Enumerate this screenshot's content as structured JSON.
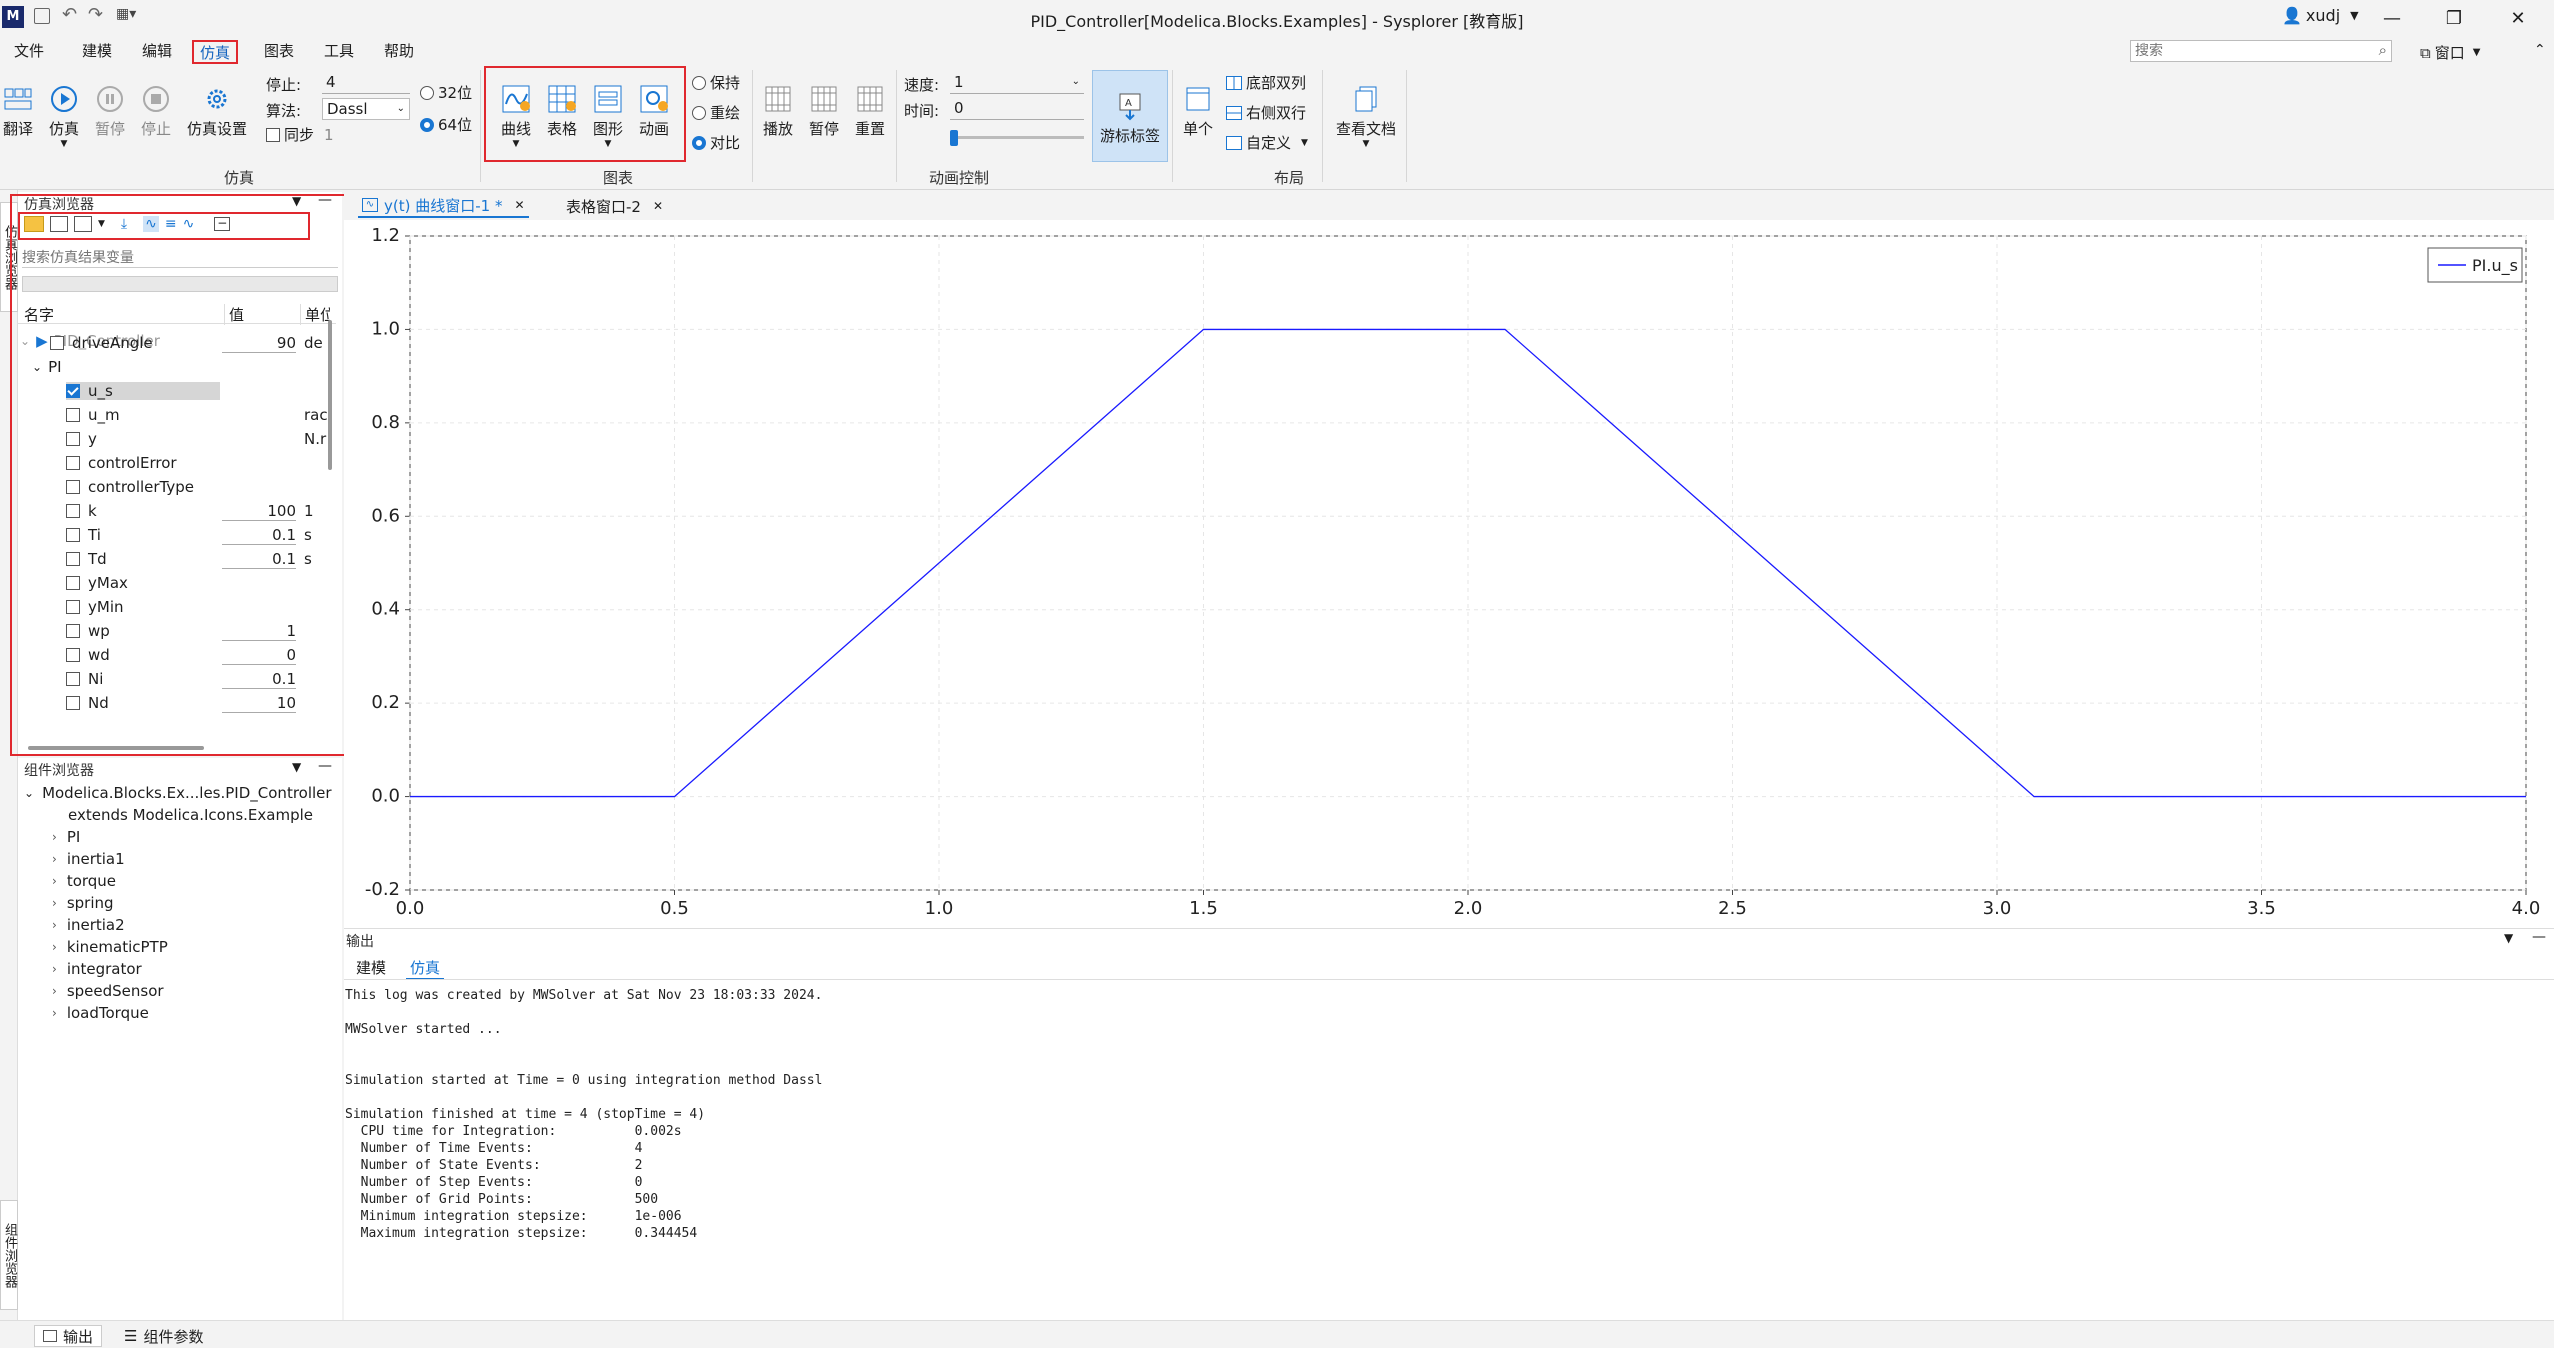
{
  "window": {
    "title": "PID_Controller[Modelica.Blocks.Examples] - Sysplorer [教育版]",
    "user": "xudj",
    "search_placeholder": "搜索",
    "window_menu": "窗口"
  },
  "menu": {
    "items": [
      "文件",
      "建模",
      "编辑",
      "仿真",
      "图表",
      "工具",
      "帮助"
    ],
    "active": "仿真"
  },
  "ribbon": {
    "sim_group": {
      "label": "仿真",
      "buttons": [
        "翻译",
        "仿真",
        "暂停",
        "停止",
        "仿真设置"
      ],
      "stop_label": "停止:",
      "stop_value": "4",
      "algo_label": "算法:",
      "algo_value": "Dassl",
      "sync_label": "同步",
      "sync_value": "1",
      "bit32": "32位",
      "bit64": "64位"
    },
    "chart_group": {
      "label": "图表",
      "buttons": [
        "曲线",
        "表格",
        "图形",
        "动画"
      ],
      "modes": [
        "保持",
        "重绘",
        "对比"
      ],
      "selected_mode": "对比"
    },
    "anim_group": {
      "label": "动画控制",
      "buttons": [
        "播放",
        "暂停",
        "重置"
      ],
      "speed_label": "速度:",
      "speed_value": "1",
      "time_label": "时间:",
      "time_value": "0",
      "cursor_label": "游标标签"
    },
    "layout_group": {
      "label": "布局",
      "single": "单个",
      "opts": [
        "底部双列",
        "右侧双行",
        "自定义"
      ]
    },
    "docs": "查看文档"
  },
  "sim_browser": {
    "title": "仿真浏览器",
    "search_placeholder": "搜索仿真结果变量",
    "columns": [
      "名字",
      "值",
      "单位"
    ],
    "root": "PID_Controller",
    "rows": [
      {
        "name": "driveAngle",
        "value": "90",
        "unit": "de",
        "checked": false
      },
      {
        "name": "PI",
        "value": "",
        "unit": "",
        "checked": false
      },
      {
        "name": "u_s",
        "value": "",
        "unit": "",
        "checked": true
      },
      {
        "name": "u_m",
        "value": "",
        "unit": "rac",
        "checked": false
      },
      {
        "name": "y",
        "value": "",
        "unit": "N.r",
        "checked": false
      },
      {
        "name": "controlError",
        "value": "",
        "unit": "",
        "checked": false
      },
      {
        "name": "controllerType",
        "value": "",
        "unit": "",
        "checked": false
      },
      {
        "name": "k",
        "value": "100",
        "unit": "1",
        "checked": false
      },
      {
        "name": "Ti",
        "value": "0.1",
        "unit": "s",
        "checked": false
      },
      {
        "name": "Td",
        "value": "0.1",
        "unit": "s",
        "checked": false
      },
      {
        "name": "yMax",
        "value": "",
        "unit": "",
        "checked": false
      },
      {
        "name": "yMin",
        "value": "",
        "unit": "",
        "checked": false
      },
      {
        "name": "wp",
        "value": "1",
        "unit": "",
        "checked": false
      },
      {
        "name": "wd",
        "value": "0",
        "unit": "",
        "checked": false
      },
      {
        "name": "Ni",
        "value": "0.1",
        "unit": "",
        "checked": false
      },
      {
        "name": "Nd",
        "value": "10",
        "unit": "",
        "checked": false
      }
    ]
  },
  "comp_browser": {
    "title": "组件浏览器",
    "root": "Modelica.Blocks.Ex...les.PID_Controller",
    "extends": "extends Modelica.Icons.Example",
    "items": [
      "PI",
      "inertia1",
      "torque",
      "spring",
      "inertia2",
      "kinematicPTP",
      "integrator",
      "speedSensor",
      "loadTorque"
    ]
  },
  "side_tabs": {
    "top": "仿真浏览器",
    "bottom": "组件浏览器"
  },
  "doc_tabs": [
    "y(t) 曲线窗口-1 *",
    "表格窗口-2"
  ],
  "chart_data": {
    "type": "line",
    "x_ticks": [
      "0.0",
      "0.5",
      "1.0",
      "1.5",
      "2.0",
      "2.5",
      "3.0",
      "3.5",
      "4.0"
    ],
    "y_ticks": [
      "-0.2",
      "0.0",
      "0.2",
      "0.4",
      "0.6",
      "0.8",
      "1.0",
      "1.2"
    ],
    "xlim": [
      0,
      4
    ],
    "ylim": [
      -0.2,
      1.2
    ],
    "grid": true,
    "legend": "top-right",
    "series": [
      {
        "name": "PI.u_s",
        "color": "#1a1aff",
        "x": [
          0,
          0.5,
          1.5,
          2.07,
          3.07,
          4.0
        ],
        "y": [
          0,
          0,
          1,
          1,
          0,
          0
        ]
      }
    ]
  },
  "output": {
    "title": "输出",
    "tabs": [
      "建模",
      "仿真"
    ],
    "active_tab": "仿真",
    "lines": [
      "This log was created by MWSolver at Sat Nov 23 18:03:33 2024.",
      "",
      "MWSolver started ...",
      "",
      "",
      "Simulation started at Time = 0 using integration method Dassl",
      "",
      "Simulation finished at time = 4 (stopTime = 4)",
      "  CPU time for Integration:          0.002s",
      "  Number of Time Events:             4",
      "  Number of State Events:            2",
      "  Number of Step Events:             0",
      "  Number of Grid Points:             500",
      "  Minimum integration stepsize:      1e-006",
      "  Maximum integration stepsize:      0.344454"
    ]
  },
  "status_tabs": [
    "输出",
    "组件参数"
  ]
}
